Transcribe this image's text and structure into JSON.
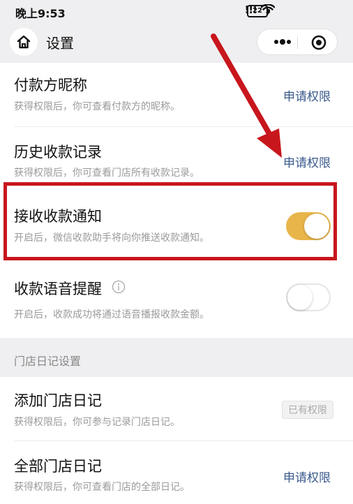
{
  "status_bar": {
    "time": "晚上9:53",
    "signal": "!!!",
    "battery": "22"
  },
  "nav": {
    "title": "设置"
  },
  "rows": [
    {
      "title": "付款方昵称",
      "desc": "获得权限后，你可查看付款方的昵称。",
      "action": "申请权限"
    },
    {
      "title": "历史收款记录",
      "desc": "获得权限后，你可查看门店所有收款记录。",
      "action": "申请权限"
    },
    {
      "title": "接收收款通知",
      "desc": "开启后，微信收款助手将向你推送收款通知。",
      "toggle_on": true
    },
    {
      "title": "收款语音提醒",
      "desc": "开启后，收款成功将通过语音播报收款金额。",
      "toggle_on": false
    }
  ],
  "section": {
    "label": "门店日记设置"
  },
  "diary_rows": [
    {
      "title": "添加门店日记",
      "desc": "获得权限后，你可参与记录门店日记。",
      "badge": "已有权限"
    },
    {
      "title": "全部门店日记",
      "desc": "获得权限后，你可查看门店的全部日记。",
      "action": "申请权限"
    }
  ],
  "colors": {
    "toggle_on": "#e8b54a",
    "highlight": "#c8161d",
    "link": "#3a5a8c"
  }
}
